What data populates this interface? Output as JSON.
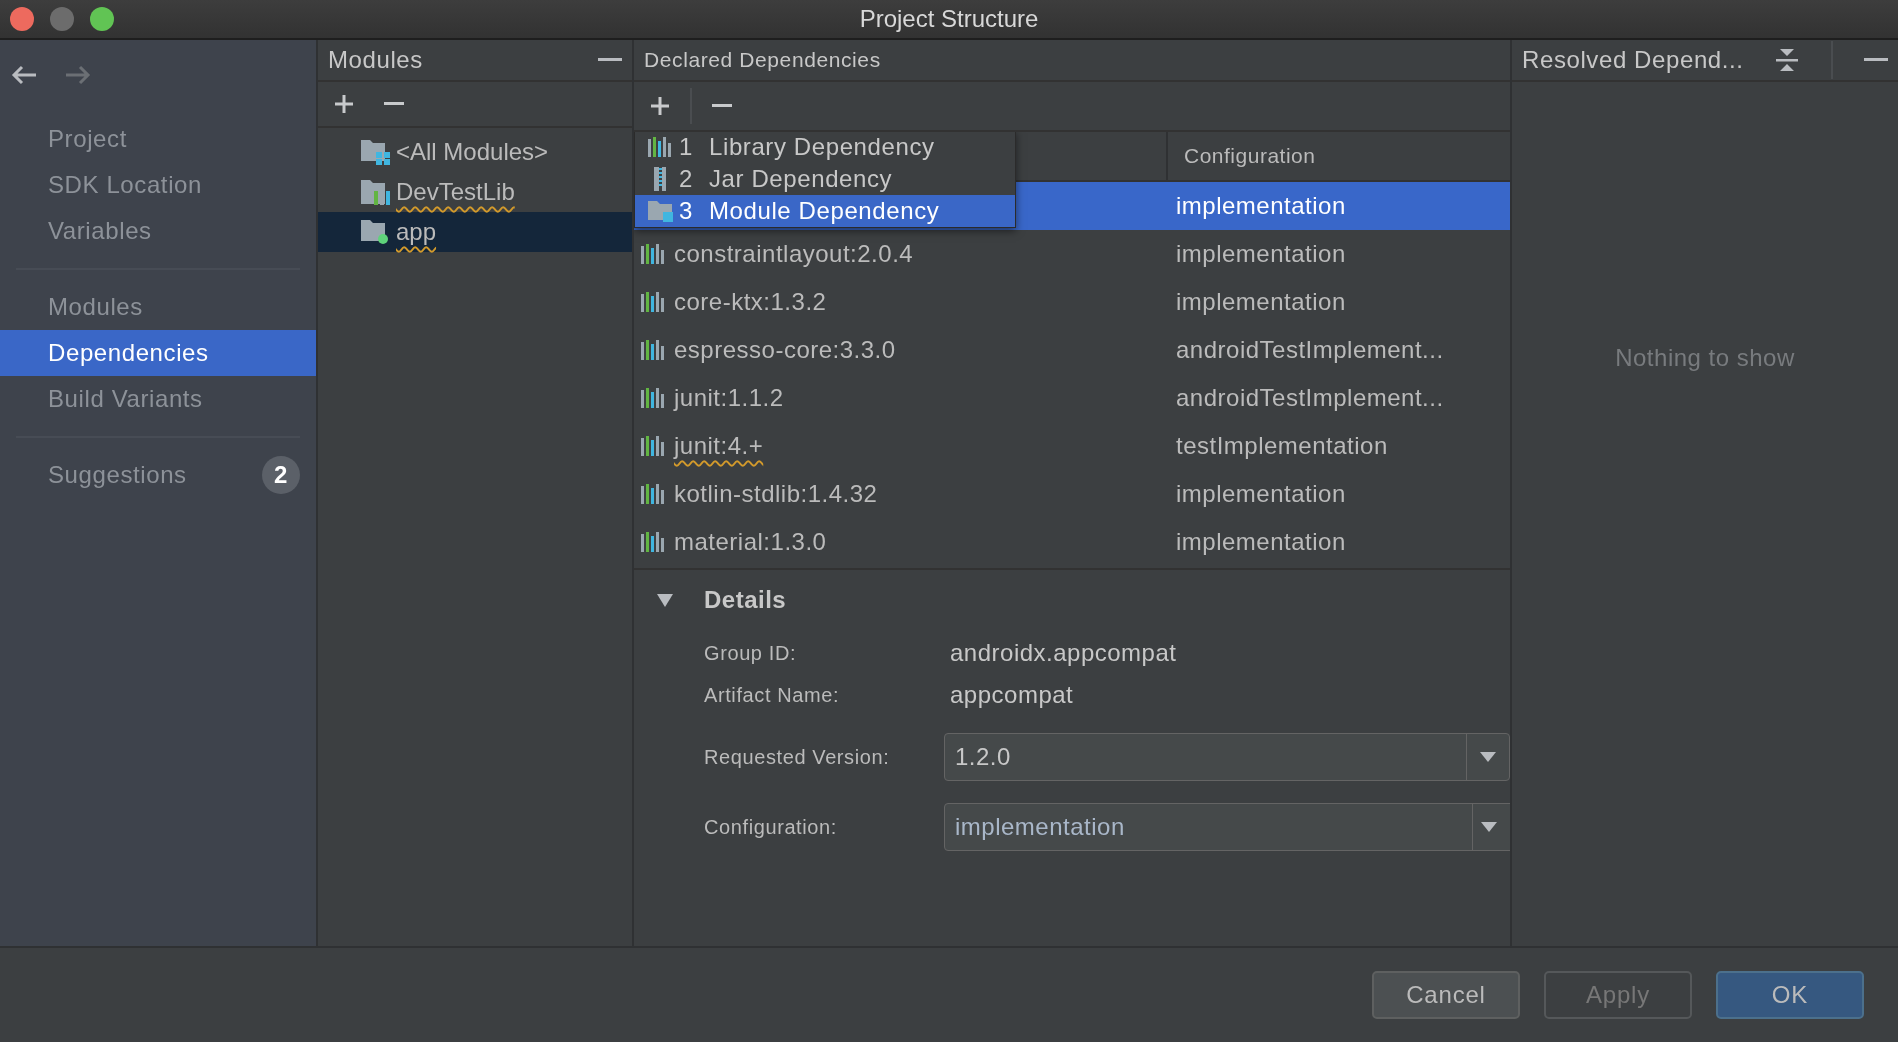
{
  "window": {
    "title": "Project Structure"
  },
  "sidebar": {
    "sections": [
      {
        "items": [
          {
            "label": "Project",
            "selected": false
          },
          {
            "label": "SDK Location",
            "selected": false
          },
          {
            "label": "Variables",
            "selected": false
          }
        ]
      },
      {
        "items": [
          {
            "label": "Modules",
            "selected": false
          },
          {
            "label": "Dependencies",
            "selected": true
          },
          {
            "label": "Build Variants",
            "selected": false
          }
        ]
      },
      {
        "items": [
          {
            "label": "Suggestions",
            "selected": false,
            "badge": "2"
          }
        ]
      }
    ]
  },
  "modules": {
    "title": "Modules",
    "items": [
      {
        "label": "<All Modules>",
        "kind": "all",
        "selected": false,
        "warning": false
      },
      {
        "label": "DevTestLib",
        "kind": "library",
        "selected": false,
        "warning": true
      },
      {
        "label": "app",
        "kind": "app",
        "selected": true,
        "warning": true
      }
    ]
  },
  "declared": {
    "title": "Declared Dependencies",
    "columns": [
      "Configuration"
    ],
    "rows": [
      {
        "configuration": "implementation",
        "selected": true
      },
      {
        "name": "constraintlayout:2.0.4",
        "configuration": "implementation",
        "selected": false,
        "warning": false
      },
      {
        "name": "core-ktx:1.3.2",
        "configuration": "implementation",
        "selected": false,
        "warning": false
      },
      {
        "name": "espresso-core:3.3.0",
        "configuration": "androidTestImplement...",
        "selected": false,
        "warning": false
      },
      {
        "name": "junit:1.1.2",
        "configuration": "androidTestImplement...",
        "selected": false,
        "warning": false
      },
      {
        "name": "junit:4.+",
        "configuration": "testImplementation",
        "selected": false,
        "warning": true
      },
      {
        "name": "kotlin-stdlib:1.4.32",
        "configuration": "implementation",
        "selected": false,
        "warning": false
      },
      {
        "name": "material:1.3.0",
        "configuration": "implementation",
        "selected": false,
        "warning": false
      }
    ],
    "add_menu": [
      {
        "number": "1",
        "label": "Library Dependency",
        "kind": "library",
        "selected": false
      },
      {
        "number": "2",
        "label": "Jar Dependency",
        "kind": "jar",
        "selected": false
      },
      {
        "number": "3",
        "label": "Module Dependency",
        "kind": "module",
        "selected": true
      }
    ]
  },
  "details": {
    "title": "Details",
    "expanded": true,
    "fields": [
      {
        "label": "Group ID:",
        "value": "androidx.appcompat",
        "kind": "text"
      },
      {
        "label": "Artifact Name:",
        "value": "appcompat",
        "kind": "text"
      },
      {
        "label": "Requested Version:",
        "value": "1.2.0",
        "kind": "combo"
      },
      {
        "label": "Configuration:",
        "value": "implementation",
        "kind": "combo"
      }
    ]
  },
  "resolved": {
    "title": "Resolved Depend...",
    "empty_text": "Nothing to show"
  },
  "buttons": [
    {
      "label": "Cancel",
      "disabled": false,
      "default": false
    },
    {
      "label": "Apply",
      "disabled": true,
      "default": false
    },
    {
      "label": "OK",
      "disabled": false,
      "default": true
    }
  ]
}
